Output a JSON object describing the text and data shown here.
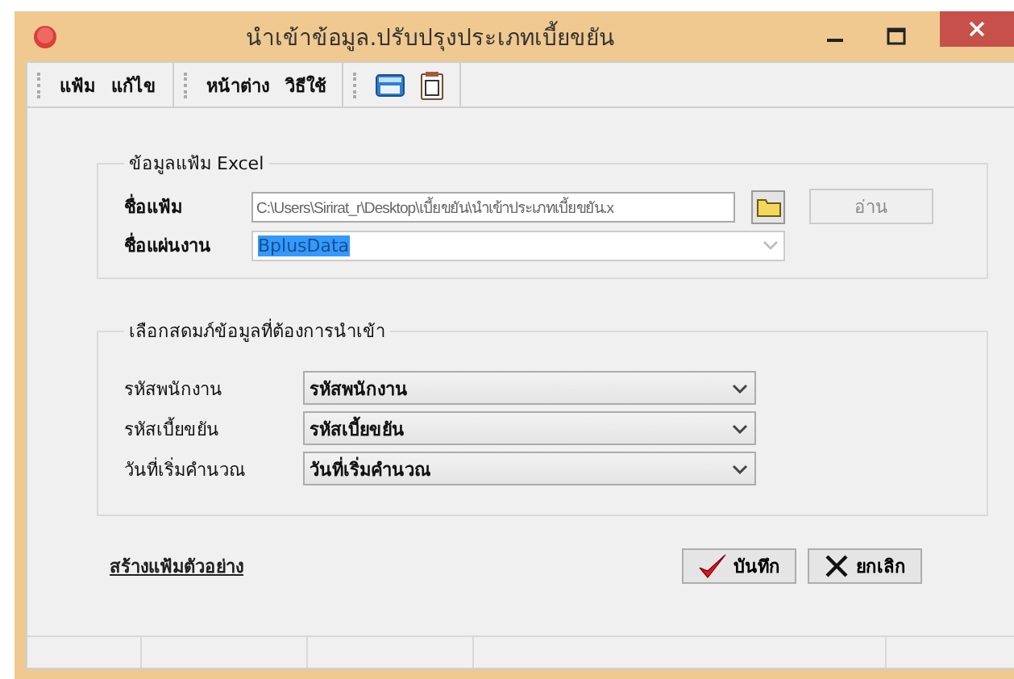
{
  "window": {
    "title": "นำเข้าข้อมูล.ปรับปรุงประเภทเบี้ยขยัน"
  },
  "menu": [
    "แฟ้ม",
    "แก้ไข",
    "หน้าต่าง",
    "วิธีใช้"
  ],
  "excel_group": {
    "title": "ข้อมูลแฟ้ม Excel",
    "file_label": "ชื่อแฟ้ม",
    "file_value": "C:\\Users\\Sirirat_r\\Desktop\\เบี้ยขยัน\\นำเข้าประเภทเบี้ยขยัน.x",
    "read_button": {
      "label": "อ่าน",
      "disabled": true
    },
    "sheet_label": "ชื่อแผ่นงาน",
    "sheet_value": "BplusData",
    "sheet_value_selected": true
  },
  "mapping_group": {
    "title": "เลือกสดมภ์ข้อมูลที่ต้องการนำเข้า",
    "rows": [
      {
        "label": "รหัสพนักงาน",
        "value": "รหัสพนักงาน"
      },
      {
        "label": "รหัสเบี้ยขยัน",
        "value": "รหัสเบี้ยขยัน"
      },
      {
        "label": "วันที่เริ่มคำนวณ",
        "value": "วันที่เริ่มคำนวณ"
      }
    ]
  },
  "sample_link": "สร้างแฟ้มตัวอย่าง",
  "buttons": [
    {
      "kind": "save",
      "label": "บันทึก"
    },
    {
      "kind": "cancel",
      "label": "ยกเลิก"
    }
  ]
}
